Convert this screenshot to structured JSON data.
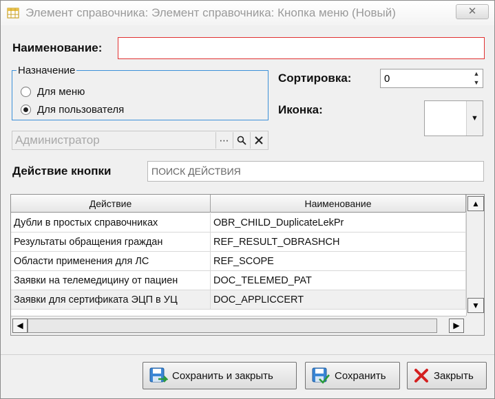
{
  "window": {
    "title": "Элемент справочника: Элемент справочника: Кнопка меню (Новый)",
    "close_label": "✕"
  },
  "form": {
    "name_label": "Наименование:",
    "name_value": "",
    "purpose": {
      "legend": "Назначение",
      "options": [
        {
          "label": "Для меню",
          "checked": false
        },
        {
          "label": "Для пользователя",
          "checked": true
        }
      ]
    },
    "sort_label": "Сортировка:",
    "sort_value": "0",
    "icon_label": "Иконка:",
    "user_value": "Администратор",
    "action_label": "Действие кнопки",
    "action_search_value": "ПОИСК ДЕЙСТВИЯ"
  },
  "grid": {
    "columns": [
      "Действие",
      "Наименование"
    ],
    "rows": [
      [
        "Дубли в простых справочниках",
        "OBR_CHILD_DuplicateLekPr"
      ],
      [
        "Результаты обращения граждан",
        "REF_RESULT_OBRASHCH"
      ],
      [
        "Области применения для ЛС",
        "REF_SCOPE"
      ],
      [
        "Заявки на телемедицину от пациен",
        "DOC_TELEMED_PAT"
      ],
      [
        "Заявки для сертификата ЭЦП в УЦ",
        "DOC_APPLICCERT"
      ]
    ]
  },
  "buttons": {
    "save_close": "Сохранить и закрыть",
    "save": "Сохранить",
    "close": "Закрыть"
  },
  "colors": {
    "required_border": "#e03030",
    "group_border": "#3b8fd8"
  }
}
